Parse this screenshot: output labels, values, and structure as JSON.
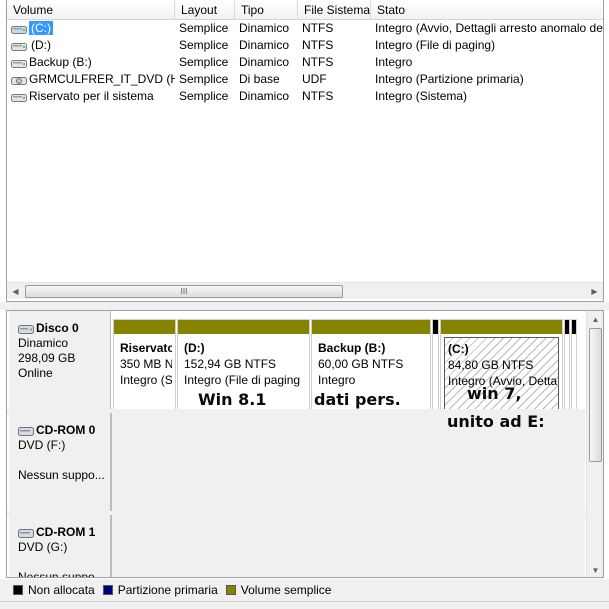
{
  "volume_list": {
    "columns": [
      "Volume",
      "Layout",
      "Tipo",
      "File Sistema",
      "Stato"
    ],
    "rows": [
      {
        "volume": "(C:)",
        "layout": "Semplice",
        "tipo": "Dinamico",
        "fs": "NTFS",
        "stato": "Integro (Avvio, Dettagli arresto anomalo de",
        "selected": true,
        "icon": "volume-icon"
      },
      {
        "volume": "(D:)",
        "layout": "Semplice",
        "tipo": "Dinamico",
        "fs": "NTFS",
        "stato": "Integro (File di paging)",
        "selected": false,
        "icon": "volume-icon"
      },
      {
        "volume": "Backup (B:)",
        "layout": "Semplice",
        "tipo": "Dinamico",
        "fs": "NTFS",
        "stato": "Integro",
        "selected": false,
        "icon": "volume-icon"
      },
      {
        "volume": "GRMCULFRER_IT_DVD (H:)",
        "layout": "Semplice",
        "tipo": "Di base",
        "fs": "UDF",
        "stato": "Integro (Partizione primaria)",
        "selected": false,
        "icon": "dvd-icon"
      },
      {
        "volume": "Riservato per il sistema",
        "layout": "Semplice",
        "tipo": "Dinamico",
        "fs": "NTFS",
        "stato": "Integro (Sistema)",
        "selected": false,
        "icon": "volume-icon"
      }
    ],
    "hscroll_grip": "III"
  },
  "disks": [
    {
      "title": "Disco 0",
      "type": "Dinamico",
      "size": "298,09 GB",
      "status": "Online",
      "partitions": [
        {
          "name": "Riservato",
          "size": "350 MB N",
          "status": "Integro (S",
          "bar": "#848400"
        },
        {
          "name": "(D:)",
          "size": "152,94 GB NTFS",
          "status": "Integro (File di paging",
          "bar": "#848400"
        },
        {
          "name": "Backup  (B:)",
          "size": "60,00 GB NTFS",
          "status": "Integro",
          "bar": "#848400"
        },
        {
          "name": "(C:)",
          "size": "84,80 GB NTFS",
          "status": "Integro (Avvio, Detta",
          "bar": "#848400",
          "selected": true
        }
      ]
    },
    {
      "title": "CD-ROM 0",
      "drive": "DVD (F:)",
      "media": "Nessun suppo..."
    },
    {
      "title": "CD-ROM 1",
      "drive": "DVD (G:)",
      "media": "Nessun suppo..."
    }
  ],
  "annotations": {
    "win81": "Win 8.1",
    "dati": "dati pers.",
    "win7": "win 7,",
    "unito": "unito  ad E:"
  },
  "legend": [
    {
      "label": "Non allocata",
      "color": "#000000"
    },
    {
      "label": "Partizione primaria",
      "color": "#000080"
    },
    {
      "label": "Volume semplice",
      "color": "#848400"
    }
  ]
}
